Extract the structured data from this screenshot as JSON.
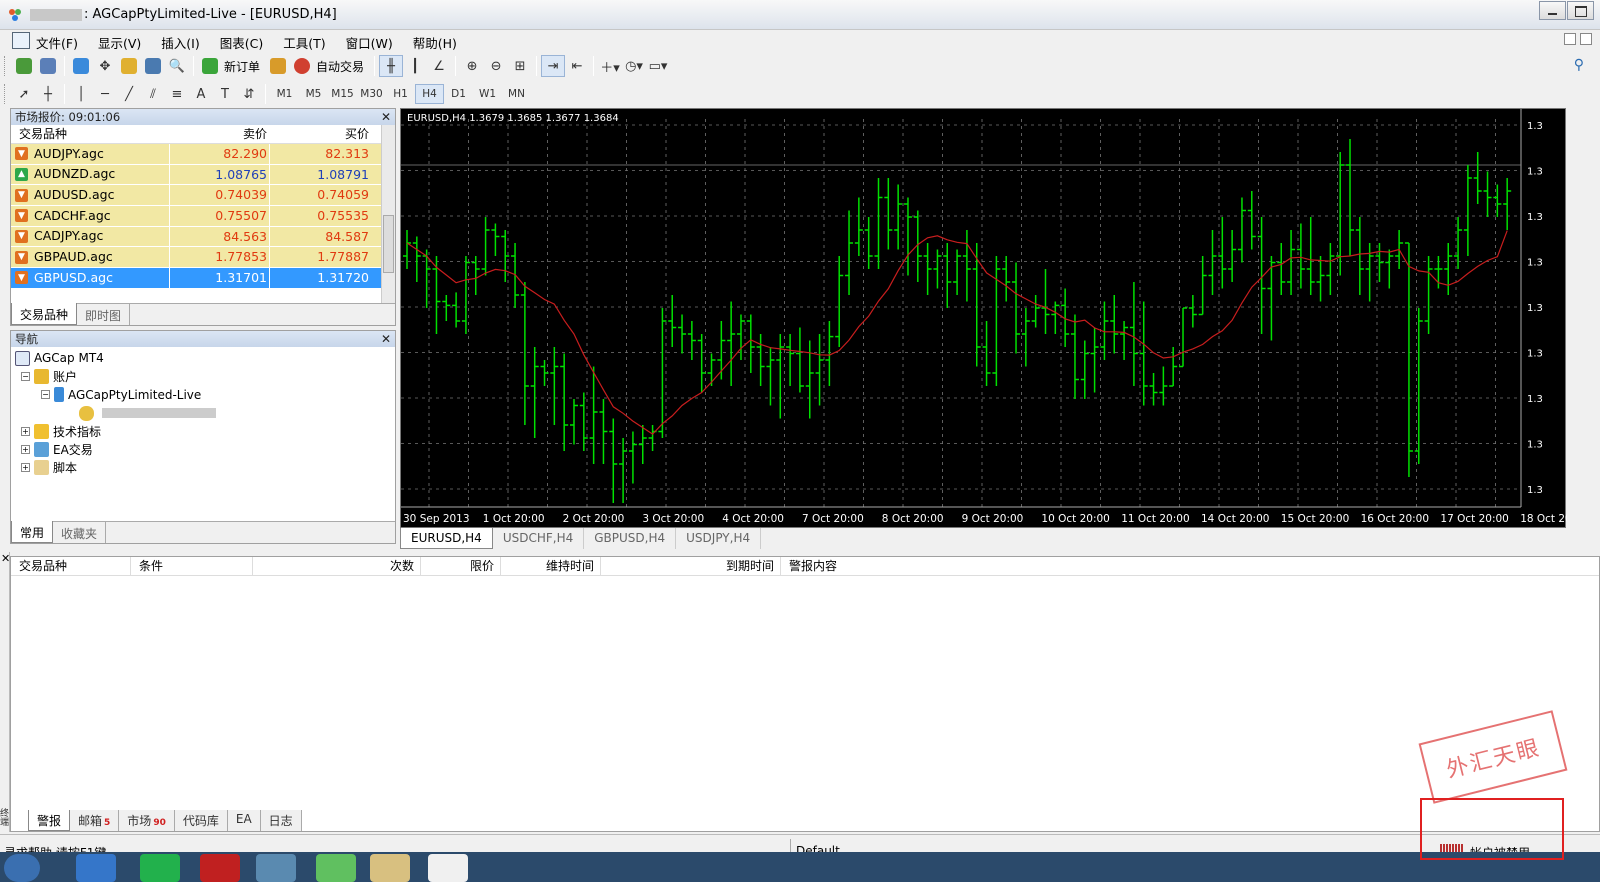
{
  "window": {
    "title": ": AGCapPtyLimited-Live - [EURUSD,H4]"
  },
  "menu": [
    "文件(F)",
    "显示(V)",
    "插入(I)",
    "图表(C)",
    "工具(T)",
    "窗口(W)",
    "帮助(H)"
  ],
  "toolbar": {
    "new_order": "新订单",
    "auto_trading": "自动交易",
    "timeframes": [
      "M1",
      "M5",
      "M15",
      "M30",
      "H1",
      "H4",
      "D1",
      "W1",
      "MN"
    ],
    "active_tf": "H4"
  },
  "market_watch": {
    "title": "市场报价: 09:01:06",
    "headers": {
      "symbol": "交易品种",
      "bid": "卖价",
      "ask": "买价"
    },
    "rows": [
      {
        "symbol": "AUDJPY.agc",
        "bid": "82.290",
        "ask": "82.313",
        "dir": "down"
      },
      {
        "symbol": "AUDNZD.agc",
        "bid": "1.08765",
        "ask": "1.08791",
        "dir": "up"
      },
      {
        "symbol": "AUDUSD.agc",
        "bid": "0.74039",
        "ask": "0.74059",
        "dir": "down"
      },
      {
        "symbol": "CADCHF.agc",
        "bid": "0.75507",
        "ask": "0.75535",
        "dir": "down"
      },
      {
        "symbol": "CADJPY.agc",
        "bid": "84.563",
        "ask": "84.587",
        "dir": "down"
      },
      {
        "symbol": "GBPAUD.agc",
        "bid": "1.77853",
        "ask": "1.77887",
        "dir": "down"
      },
      {
        "symbol": "GBPUSD.agc",
        "bid": "1.31701",
        "ask": "1.31720",
        "dir": "down"
      }
    ],
    "tabs": [
      "交易品种",
      "即时图"
    ]
  },
  "navigator": {
    "title": "导航",
    "root": "AGCap MT4",
    "accounts": "账户",
    "account_name": "AGCapPtyLimited-Live",
    "indicators": "技术指标",
    "experts": "EA交易",
    "scripts": "脚本",
    "tabs": [
      "常用",
      "收藏夹"
    ]
  },
  "chart": {
    "info": "EURUSD,H4  1.3679 1.3685 1.3677 1.3684",
    "xlabels": [
      "30 Sep 2013",
      "1 Oct 20:00",
      "2 Oct 20:00",
      "3 Oct 20:00",
      "4 Oct 20:00",
      "7 Oct 20:00",
      "8 Oct 20:00",
      "9 Oct 20:00",
      "10 Oct 20:00",
      "11 Oct 20:00",
      "14 Oct 20:00",
      "15 Oct 20:00",
      "16 Oct 20:00",
      "17 Oct 20:00",
      "18 Oct 20:00"
    ],
    "ylabels": [
      "1.3",
      "1.3",
      "1.3",
      "1.3",
      "1.3",
      "1.3",
      "1.3",
      "1.3",
      "1.3"
    ],
    "tabs": [
      "EURUSD,H4",
      "USDCHF,H4",
      "GBPUSD,H4",
      "USDJPY,H4"
    ],
    "bar_color": "#00e000",
    "ma_color": "#c81e1e"
  },
  "terminal": {
    "headers": [
      "交易品种",
      "条件",
      "次数",
      "限价",
      "维持时间",
      "到期时间",
      "警报内容"
    ],
    "tabs": [
      {
        "label": "警报",
        "badge": ""
      },
      {
        "label": "邮箱",
        "badge": "5"
      },
      {
        "label": "市场",
        "badge": "90"
      },
      {
        "label": "代码库",
        "badge": ""
      },
      {
        "label": "EA",
        "badge": ""
      },
      {
        "label": "日志",
        "badge": ""
      }
    ],
    "side_label": "终端"
  },
  "status": {
    "help": "寻求帮助,请按F1键",
    "profile": "Default",
    "connection": "帐户被禁用"
  },
  "watermark": "外汇天眼"
}
